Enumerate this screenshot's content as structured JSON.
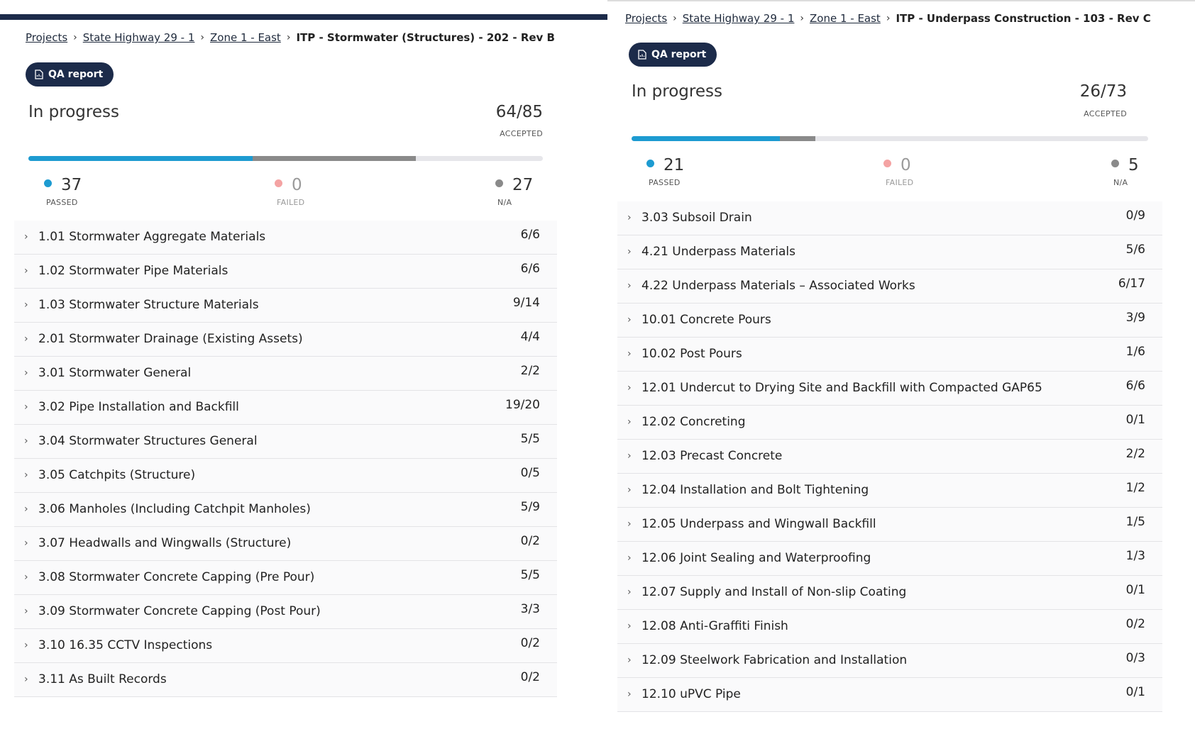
{
  "left": {
    "breadcrumb": {
      "projects": "Projects",
      "project": "State Highway 29 - 1",
      "zone": "Zone 1 - East",
      "current": "ITP - Stormwater (Structures) - 202 - Rev B"
    },
    "qa_button": "QA report",
    "status": "In progress",
    "accepted_count": "64/85",
    "accepted_label": "ACCEPTED",
    "progress": {
      "passed": 37,
      "na": 27,
      "total": 85
    },
    "stats": {
      "passed": {
        "value": "37",
        "label": "PASSED",
        "color": "#1d9bd1"
      },
      "failed": {
        "value": "0",
        "label": "FAILED",
        "color": "#f4a3a3"
      },
      "na": {
        "value": "27",
        "label": "N/A",
        "color": "#8a8a8a"
      }
    },
    "items": [
      {
        "title": "1.01 Stormwater Aggregate Materials",
        "count": "6/6"
      },
      {
        "title": "1.02 Stormwater Pipe Materials",
        "count": "6/6"
      },
      {
        "title": "1.03 Stormwater Structure Materials",
        "count": "9/14"
      },
      {
        "title": "2.01 Stormwater Drainage (Existing Assets)",
        "count": "4/4"
      },
      {
        "title": "3.01 Stormwater General",
        "count": "2/2"
      },
      {
        "title": "3.02 Pipe Installation and Backfill",
        "count": "19/20"
      },
      {
        "title": "3.04 Stormwater Structures General",
        "count": "5/5"
      },
      {
        "title": "3.05 Catchpits (Structure)",
        "count": "0/5"
      },
      {
        "title": "3.06 Manholes (Including Catchpit Manholes)",
        "count": "5/9"
      },
      {
        "title": "3.07 Headwalls and Wingwalls (Structure)",
        "count": "0/2"
      },
      {
        "title": "3.08 Stormwater Concrete Capping (Pre Pour)",
        "count": "5/5"
      },
      {
        "title": "3.09 Stormwater Concrete Capping (Post Pour)",
        "count": "3/3"
      },
      {
        "title": "3.10 16.35 CCTV Inspections",
        "count": "0/2"
      },
      {
        "title": "3.11 As Built Records",
        "count": "0/2"
      }
    ]
  },
  "right": {
    "breadcrumb": {
      "projects": "Projects",
      "project": "State Highway 29 - 1",
      "zone": "Zone 1 - East",
      "current": "ITP - Underpass Construction - 103 - Rev C"
    },
    "qa_button": "QA report",
    "status": "In progress",
    "accepted_count": "26/73",
    "accepted_label": "ACCEPTED",
    "progress": {
      "passed": 21,
      "na": 5,
      "total": 73
    },
    "stats": {
      "passed": {
        "value": "21",
        "label": "PASSED",
        "color": "#1d9bd1"
      },
      "failed": {
        "value": "0",
        "label": "FAILED",
        "color": "#f4a3a3"
      },
      "na": {
        "value": "5",
        "label": "N/A",
        "color": "#8a8a8a"
      }
    },
    "items": [
      {
        "title": "3.03 Subsoil Drain",
        "count": "0/9"
      },
      {
        "title": "4.21 Underpass Materials",
        "count": "5/6"
      },
      {
        "title": "4.22 Underpass Materials – Associated Works",
        "count": "6/17"
      },
      {
        "title": "10.01 Concrete Pours",
        "count": "3/9"
      },
      {
        "title": "10.02 Post Pours",
        "count": "1/6"
      },
      {
        "title": "12.01 Undercut to Drying Site and Backfill with Compacted GAP65",
        "count": "6/6"
      },
      {
        "title": "12.02 Concreting",
        "count": "0/1"
      },
      {
        "title": "12.03 Precast Concrete",
        "count": "2/2"
      },
      {
        "title": "12.04 Installation and Bolt Tightening",
        "count": "1/2"
      },
      {
        "title": "12.05 Underpass and Wingwall Backfill",
        "count": "1/5"
      },
      {
        "title": "12.06 Joint Sealing and Waterproofing",
        "count": "1/3"
      },
      {
        "title": "12.07 Supply and Install of Non-slip Coating",
        "count": "0/1"
      },
      {
        "title": "12.08 Anti-Graffiti Finish",
        "count": "0/2"
      },
      {
        "title": "12.09 Steelwork Fabrication and Installation",
        "count": "0/3"
      },
      {
        "title": "12.10 uPVC Pipe",
        "count": "0/1"
      }
    ]
  }
}
